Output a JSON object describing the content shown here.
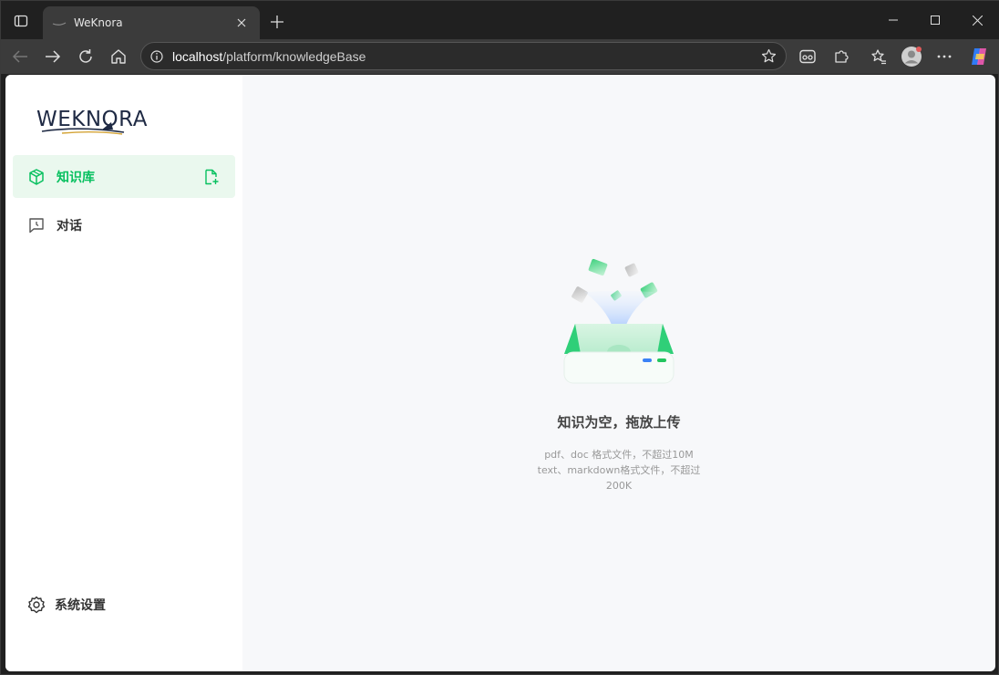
{
  "browser": {
    "tab_title": "WeKnora",
    "url_host": "localhost",
    "url_path": "/platform/knowledgeBase"
  },
  "sidebar": {
    "logo_text": "WEKNORA",
    "items": [
      {
        "label": "知识库",
        "icon": "cube-icon",
        "active": true
      },
      {
        "label": "对话",
        "icon": "chat-icon",
        "active": false
      }
    ],
    "settings_label": "系统设置"
  },
  "main": {
    "empty_title": "知识为空，拖放上传",
    "empty_desc_line1": "pdf、doc 格式文件，不超过10M",
    "empty_desc_line2": "text、markdown格式文件，不超过",
    "empty_desc_line3": "200K"
  },
  "colors": {
    "accent": "#07c05f",
    "active_bg": "#eaf8ee",
    "page_bg": "#f7f8fa"
  }
}
